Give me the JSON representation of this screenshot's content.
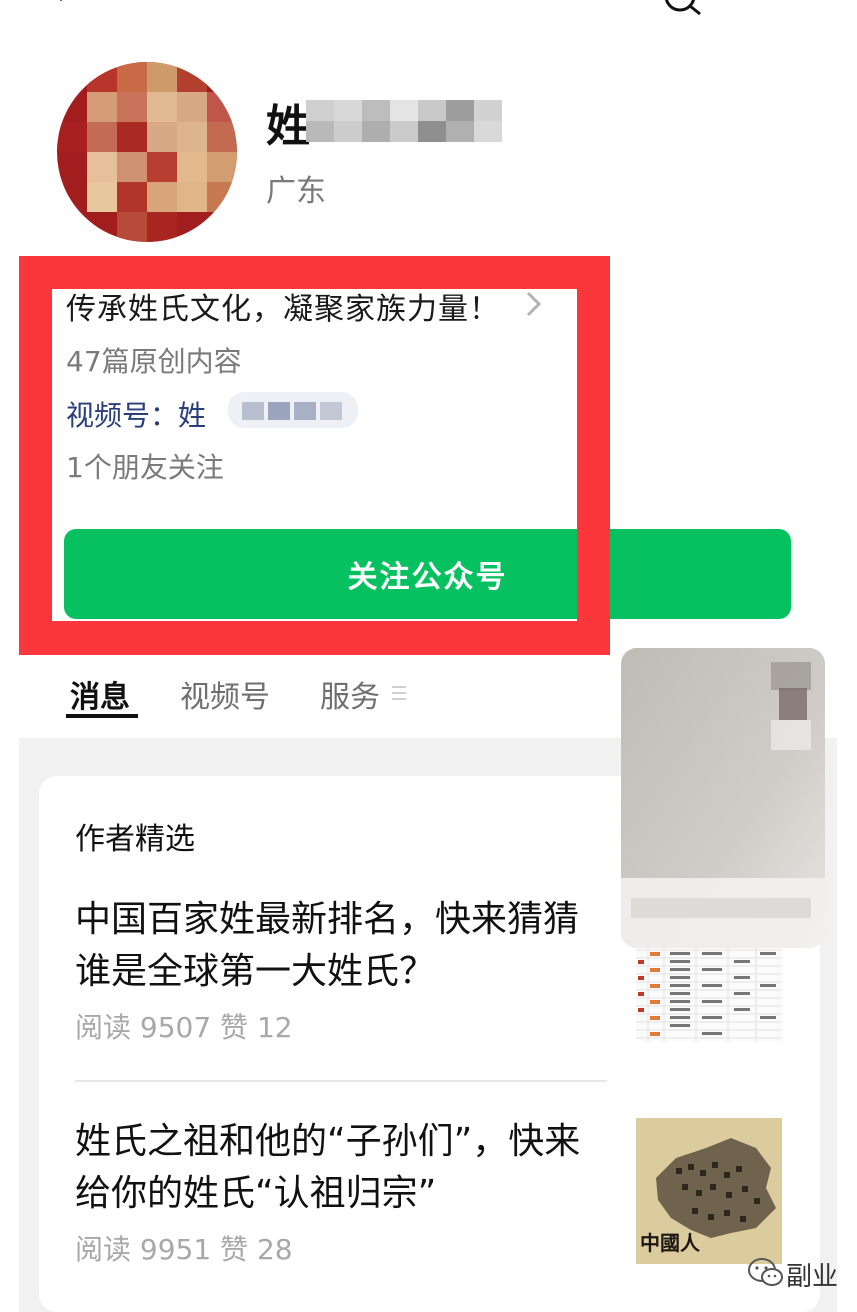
{
  "header": {
    "back_icon": "chevron-left-icon",
    "search_icon": "search-icon"
  },
  "profile": {
    "name_visible": "姓",
    "region": "广东",
    "intro": "传承姓氏文化，凝聚家族力量！",
    "original_count": "47篇原创内容",
    "video_label": "视频号：姓",
    "friends_following": "1个朋友关注",
    "follow_button": "关注公众号"
  },
  "tabs": [
    {
      "label": "消息",
      "active": true
    },
    {
      "label": "视频号",
      "active": false
    },
    {
      "label": "服务",
      "active": false
    }
  ],
  "featured": {
    "section_title": "作者精选",
    "articles": [
      {
        "title_line1": "中国百家姓最新排名，快来猜猜",
        "title_line2": "谁是全球第一大姓氏？",
        "meta": "阅读 9507   赞 12"
      },
      {
        "title_line1": "姓氏之祖和他的“子孙们”，快来",
        "title_line2": "给你的姓氏“认祖归宗”",
        "meta": "阅读 9951   赞 28"
      }
    ],
    "thumb2_caption": "中國人"
  },
  "watermark": {
    "text": "副业"
  },
  "colors": {
    "brand_green": "#07c160",
    "highlight_red": "#fc373b",
    "link_blue": "#2a3f7a"
  }
}
